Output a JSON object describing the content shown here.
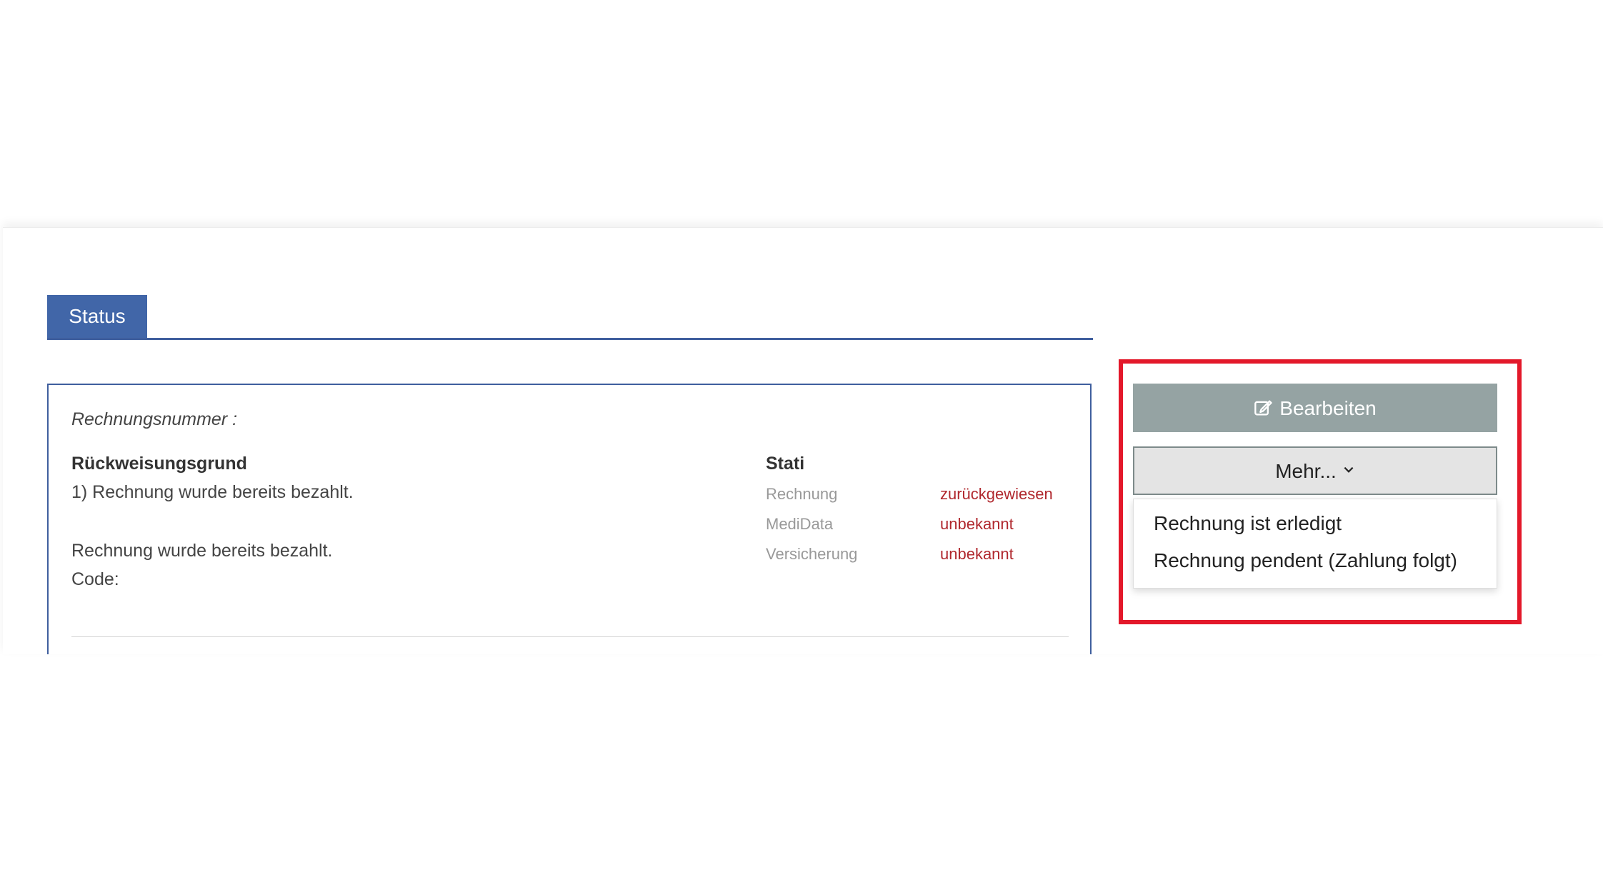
{
  "tabs": {
    "status_label": "Status"
  },
  "invoice": {
    "number_label": "Rechnungsnummer :",
    "reason_title": "Rückweisungsgrund",
    "reason_line1": "1) Rechnung wurde bereits bezahlt.",
    "reason_line2": "Rechnung wurde bereits bezahlt.",
    "code_label": "Code:"
  },
  "stati": {
    "title": "Stati",
    "rows": [
      {
        "label": "Rechnung",
        "value": "zurückgewiesen"
      },
      {
        "label": "MediData",
        "value": "unbekannt"
      },
      {
        "label": "Versicherung",
        "value": "unbekannt"
      }
    ]
  },
  "actions": {
    "edit_label": "Bearbeiten",
    "more_label": "Mehr...",
    "dropdown_items": [
      "Rechnung ist erledigt",
      "Rechnung pendent (Zahlung folgt)"
    ]
  },
  "colors": {
    "tab_blue": "#4166a8",
    "status_red": "#b0282e",
    "edit_button_gray": "#95a3a3",
    "highlight_red": "#e3182a"
  },
  "icons": {
    "edit": "edit-icon",
    "more": "chevron-down-icon"
  }
}
